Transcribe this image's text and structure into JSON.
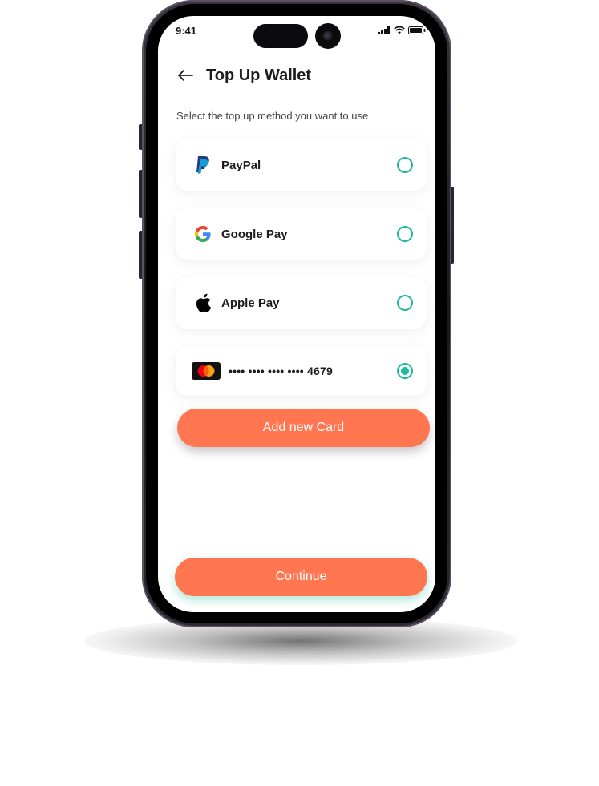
{
  "status_bar": {
    "time": "9:41"
  },
  "header": {
    "title": "Top Up Wallet",
    "back_icon": "arrow-left-icon"
  },
  "subtitle": "Select the top up method you want to use",
  "methods": [
    {
      "label": "PayPal",
      "icon": "paypal-icon",
      "selected": false
    },
    {
      "label": "Google Pay",
      "icon": "google-icon",
      "selected": false
    },
    {
      "label": "Apple Pay",
      "icon": "apple-icon",
      "selected": false
    },
    {
      "label": "•••• •••• •••• •••• 4679",
      "icon": "mastercard-icon",
      "selected": true
    }
  ],
  "add_card_button": "Add new Card",
  "continue_button": "Continue",
  "colors": {
    "accent": "#FF7650",
    "radio": "#1FB89B"
  }
}
